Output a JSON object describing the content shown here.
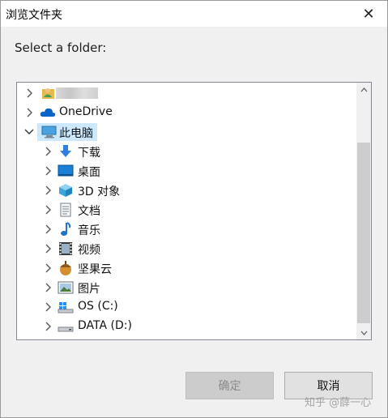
{
  "window": {
    "title": "浏览文件夹",
    "close_glyph": "✕"
  },
  "prompt": "Select a folder:",
  "tree": {
    "items": [
      {
        "label": "",
        "icon": "user-folder-icon",
        "expanded": false,
        "blurred": true
      },
      {
        "label": "OneDrive",
        "icon": "cloud-icon",
        "expanded": false
      },
      {
        "label": "此电脑",
        "icon": "computer-icon",
        "expanded": true,
        "selected": true
      },
      {
        "label": "下载",
        "icon": "download-icon",
        "expanded": false
      },
      {
        "label": "桌面",
        "icon": "desktop-icon",
        "expanded": false
      },
      {
        "label": "3D 对象",
        "icon": "3d-objects-icon",
        "expanded": false
      },
      {
        "label": "文档",
        "icon": "document-icon",
        "expanded": false
      },
      {
        "label": "音乐",
        "icon": "music-icon",
        "expanded": false
      },
      {
        "label": "视频",
        "icon": "video-icon",
        "expanded": false
      },
      {
        "label": "坚果云",
        "icon": "nutstore-icon",
        "expanded": false
      },
      {
        "label": "图片",
        "icon": "pictures-icon",
        "expanded": false
      },
      {
        "label": "OS (C:)",
        "icon": "os-drive-icon",
        "expanded": false
      },
      {
        "label": "DATA (D:)",
        "icon": "data-drive-icon",
        "expanded": false
      }
    ]
  },
  "buttons": {
    "ok_label": "确定",
    "cancel_label": "取消"
  },
  "watermark": "知乎 @薛一心",
  "colors": {
    "selection": "#cce8ff",
    "onedrive_blue": "#0a64c8",
    "download_blue": "#2f7fe0"
  }
}
